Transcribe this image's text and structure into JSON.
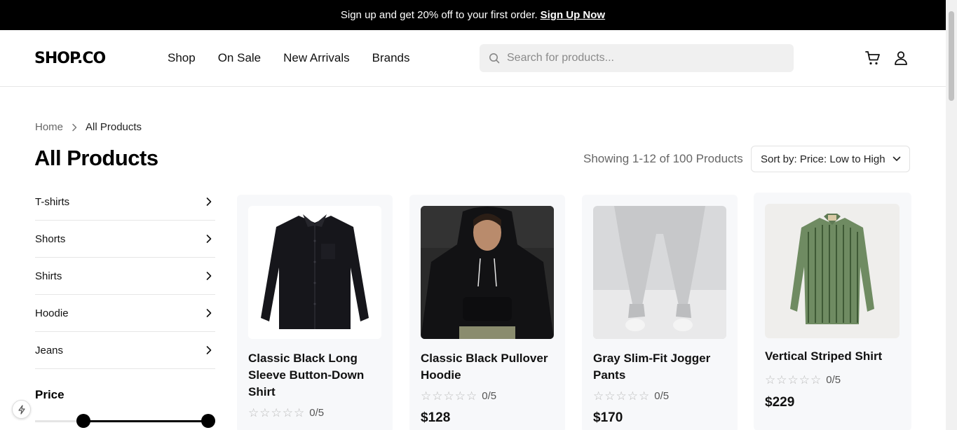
{
  "promo": {
    "text": "Sign up and get 20% off to your first order.",
    "link": "Sign Up Now"
  },
  "header": {
    "logo": "SHOP.CO",
    "nav": [
      "Shop",
      "On Sale",
      "New Arrivals",
      "Brands"
    ],
    "search_placeholder": "Search for products...",
    "icons": [
      "cart-icon",
      "user-icon"
    ]
  },
  "breadcrumb": {
    "home": "Home",
    "current": "All Products"
  },
  "page": {
    "title": "All Products",
    "showing": "Showing 1-12 of 100 Products",
    "sort": "Sort by: Price: Low to High"
  },
  "sidebar": {
    "categories": [
      "T-shirts",
      "Shorts",
      "Shirts",
      "Hoodie",
      "Jeans"
    ],
    "price_title": "Price",
    "price_range_fraction": [
      0.27,
      0.96
    ]
  },
  "products": [
    {
      "name": "Classic Black Long Sleeve Button-Down Shirt",
      "rating": "0/5",
      "price": ""
    },
    {
      "name": "Classic Black Pullover Hoodie",
      "rating": "0/5",
      "price": "$128"
    },
    {
      "name": "Gray Slim-Fit Jogger Pants",
      "rating": "0/5",
      "price": "$170"
    },
    {
      "name": "Vertical Striped Shirt",
      "rating": "0/5",
      "price": "$229"
    }
  ],
  "colors": {
    "accent": "#000000",
    "card_bg": "#f7f8fa",
    "star": "#b9b9b9"
  }
}
